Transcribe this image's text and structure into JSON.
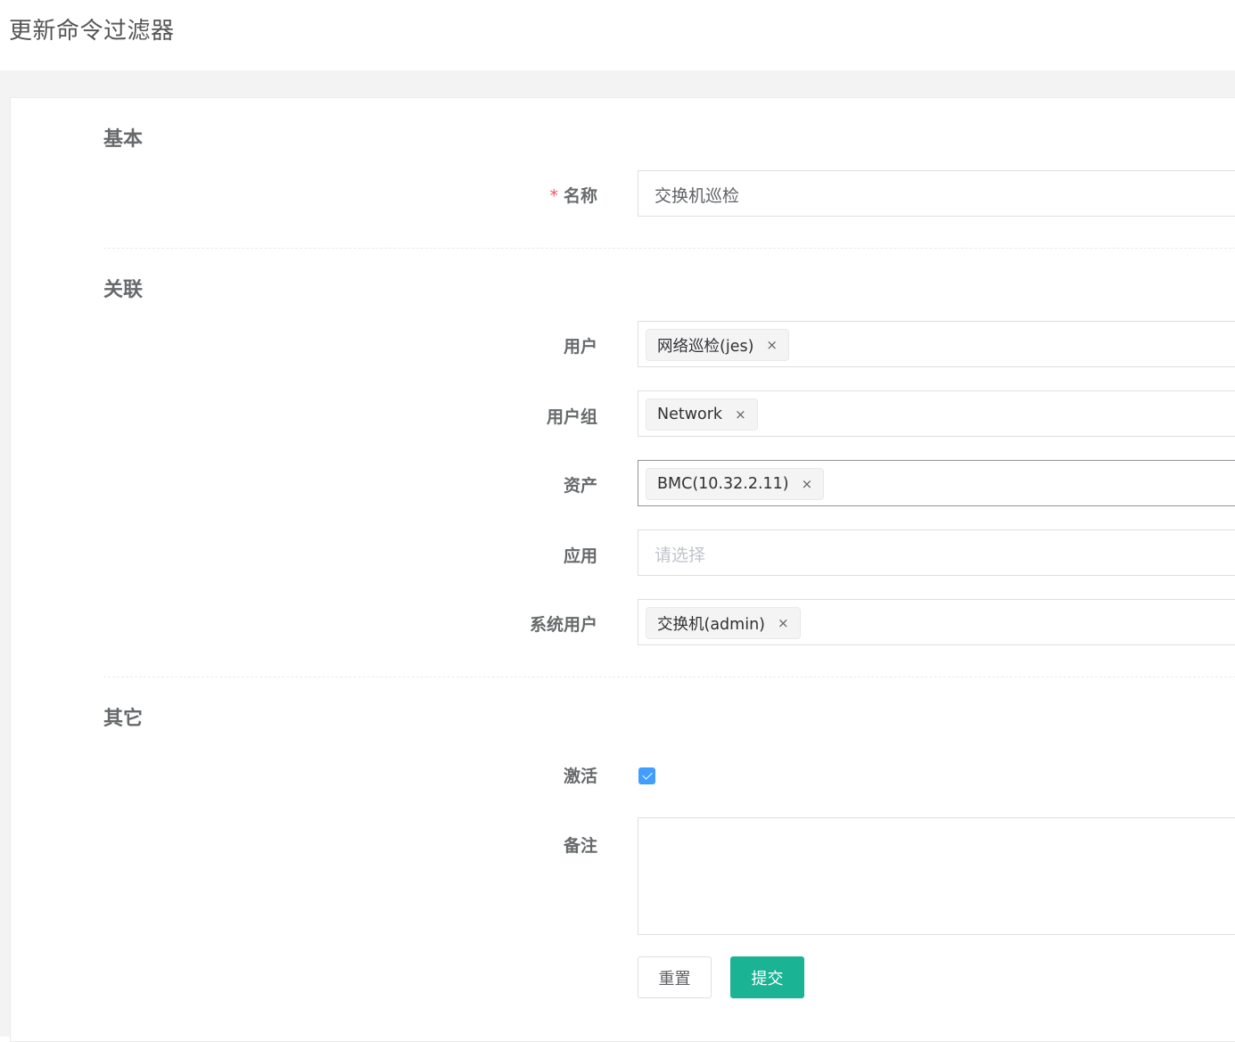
{
  "page": {
    "title": "更新命令过滤器"
  },
  "sections": {
    "basic": "基本",
    "association": "关联",
    "other": "其它"
  },
  "form": {
    "name": {
      "label": "名称",
      "required_mark": "*",
      "value": "交换机巡检"
    },
    "users": {
      "label": "用户",
      "tags": [
        "网络巡检(jes)"
      ]
    },
    "user_groups": {
      "label": "用户组",
      "tags": [
        "Network"
      ]
    },
    "assets": {
      "label": "资产",
      "tags": [
        "BMC(10.32.2.11)"
      ]
    },
    "applications": {
      "label": "应用",
      "placeholder": "请选择"
    },
    "system_users": {
      "label": "系统用户",
      "tags": [
        "交换机(admin)"
      ]
    },
    "active": {
      "label": "激活",
      "checked": true
    },
    "comment": {
      "label": "备注",
      "value": ""
    }
  },
  "buttons": {
    "reset": "重置",
    "submit": "提交"
  },
  "icons": {
    "tag_close": "×"
  },
  "colors": {
    "primary": "#1ab394",
    "checkbox": "#409eff",
    "required": "#ed5565"
  }
}
